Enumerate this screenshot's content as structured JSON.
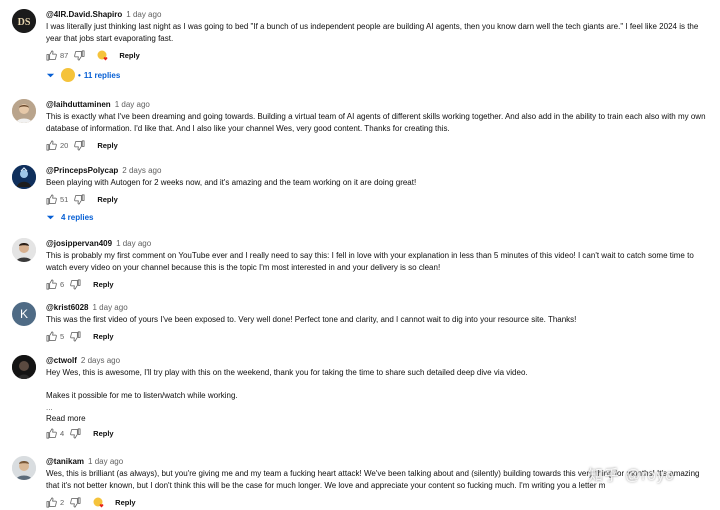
{
  "reply_label": "Reply",
  "comments": [
    {
      "handle": "@4IR.David.Shapiro",
      "time": "1 day ago",
      "text": "I was literally just thinking last night as I was going to bed \"If a bunch of us independent people are building AI agents, then you know darn well the tech giants are.\" I feel like 2024 is the year that jobs start evaporating fast.",
      "likes": "87",
      "replies": "11 replies"
    },
    {
      "handle": "@laihduttaminen",
      "time": "1 day ago",
      "text": "This is exactly what I've been dreaming and going towards. Building a virtual team of AI agents of different skills working together. And also add in the ability to train each also with my own database of information. I'd like that. And I also like your channel Wes, very good content. Thanks for creating this.",
      "likes": "20"
    },
    {
      "handle": "@PrincepsPolycap",
      "time": "2 days ago",
      "text": "Been playing with Autogen for 2 weeks now, and it's amazing and the team working on it are doing great!",
      "likes": "51",
      "replies": "4 replies"
    },
    {
      "handle": "@josippervan409",
      "time": "1 day ago",
      "text": "This is probably my first comment on YouTube ever and I really need to say this: I fell in love with your explanation in less than 5 minutes of this video! I can't wait to catch some time to watch every video on your channel because this is the topic I'm most interested in and your delivery is so clean!",
      "likes": "6"
    },
    {
      "handle": "@krist6028",
      "time": "1 day ago",
      "avatar_letter": "K",
      "text": "This was the first video of yours I've been exposed to. Very well done! Perfect tone and clarity, and I cannot wait to dig into your resource site. Thanks!",
      "likes": "5"
    },
    {
      "handle": "@ctwolf",
      "time": "2 days ago",
      "text": "Hey Wes, this is awesome, I'll try play with this on the weekend, thank you for taking the time to share such detailed deep dive via video.",
      "text2": "Makes it possible for me to listen/watch while working.",
      "ellipsis": "...",
      "read_more": "Read more",
      "likes": "4"
    },
    {
      "handle": "@tanikam",
      "time": "1 day ago",
      "text": "Wes, this is brilliant (as always), but you're giving me and my team a fucking heart attack! We've been talking about and (silently) building towards this very thing for months! It's amazing that it's not better known, but I don't think this will be the case for much longer. We love and appreciate your content so fucking much. I'm writing you a letter m",
      "likes": "2"
    }
  ],
  "watermark": "知乎 @royo",
  "colors": {
    "link_blue": "#065fd4",
    "muted": "#606060",
    "heart_red": "#e62117"
  },
  "icons": [
    "thumb-up-icon",
    "thumb-down-icon",
    "heart-icon",
    "chevron-down-icon"
  ]
}
